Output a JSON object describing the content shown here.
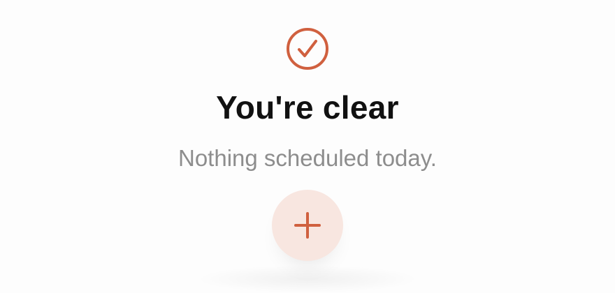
{
  "empty_state": {
    "icon": "check-circle-icon",
    "title": "You're clear",
    "subtitle": "Nothing scheduled today.",
    "add_button": {
      "icon": "plus-icon"
    }
  },
  "colors": {
    "accent": "#d0603f",
    "accent_soft": "#f8e6e0",
    "title_text": "#111111",
    "subtitle_text": "#8d8d8d",
    "background": "#fdfdfd"
  }
}
